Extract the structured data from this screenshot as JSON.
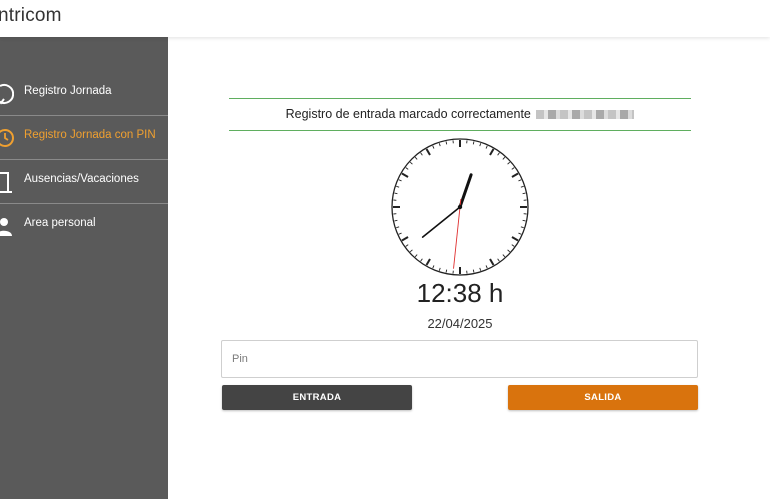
{
  "header": {
    "brand": "ntricom"
  },
  "sidebar": {
    "items": [
      {
        "label": "Registro Jornada",
        "icon": "clock-refresh-icon",
        "active": false
      },
      {
        "label": "Registro Jornada con PIN",
        "icon": "clock-pin-icon",
        "active": true
      },
      {
        "label": "Ausencias/Vacaciones",
        "icon": "door-icon",
        "active": false
      },
      {
        "label": "Area personal",
        "icon": "user-icon",
        "active": false
      }
    ]
  },
  "status": {
    "message": "Registro de entrada marcado correctamente"
  },
  "clock": {
    "hours": 12,
    "minutes": 38,
    "seconds": 31,
    "time_text": "12:38 h",
    "date_text": "22/04/2025"
  },
  "pin": {
    "placeholder": "Pin",
    "value": ""
  },
  "buttons": {
    "entrada": "ENTRADA",
    "salida": "SALIDA"
  },
  "colors": {
    "accent": "#d9730d",
    "active_nav": "#f0a030",
    "sidebar": "#5a5a5a",
    "success_line": "#5fae5f"
  }
}
